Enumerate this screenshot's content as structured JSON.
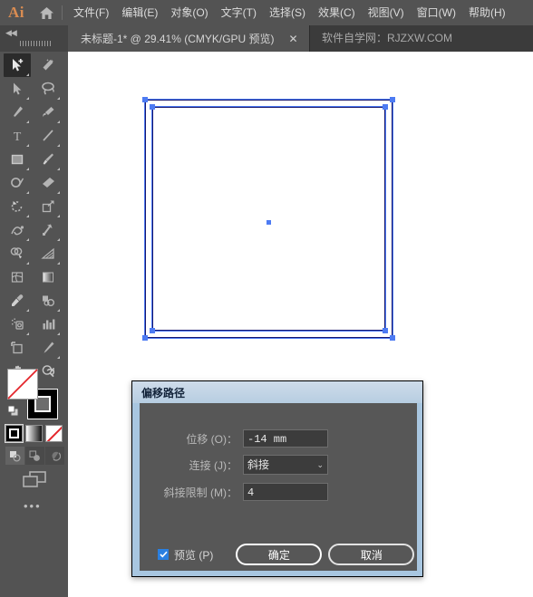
{
  "app": {
    "logo_text": "Ai",
    "home_icon": "home-icon"
  },
  "menubar": {
    "items": [
      {
        "label": "文件(F)"
      },
      {
        "label": "编辑(E)"
      },
      {
        "label": "对象(O)"
      },
      {
        "label": "文字(T)"
      },
      {
        "label": "选择(S)"
      },
      {
        "label": "效果(C)"
      },
      {
        "label": "视图(V)"
      },
      {
        "label": "窗口(W)"
      },
      {
        "label": "帮助(H)"
      }
    ]
  },
  "tabbar": {
    "document_title": "未标题-1* @ 29.41% (CMYK/GPU 预览)",
    "close_label": "✕",
    "watermark": "软件自学网：RJZXW.COM",
    "collapse_label": "◀◀"
  },
  "toolbar": {
    "tools": [
      {
        "name": "selection-plus-tool",
        "active": true
      },
      {
        "name": "magic-wand-tool",
        "active": false
      },
      {
        "name": "direct-selection-tool",
        "active": false
      },
      {
        "name": "lasso-tool",
        "active": false
      },
      {
        "name": "pen-tool",
        "active": false
      },
      {
        "name": "curvature-tool",
        "active": false
      },
      {
        "name": "type-tool",
        "active": false
      },
      {
        "name": "line-segment-tool",
        "active": false
      },
      {
        "name": "rectangle-tool",
        "active": false
      },
      {
        "name": "paintbrush-tool",
        "active": false
      },
      {
        "name": "shaper-tool",
        "active": false
      },
      {
        "name": "eraser-tool",
        "active": false
      },
      {
        "name": "rotate-tool",
        "active": false
      },
      {
        "name": "scale-tool",
        "active": false
      },
      {
        "name": "width-tool",
        "active": false
      },
      {
        "name": "free-transform-tool",
        "active": false
      },
      {
        "name": "shape-builder-tool",
        "active": false
      },
      {
        "name": "perspective-grid-tool",
        "active": false
      },
      {
        "name": "mesh-tool",
        "active": false
      },
      {
        "name": "gradient-tool",
        "active": false
      },
      {
        "name": "eyedropper-tool",
        "active": false
      },
      {
        "name": "blend-tool",
        "active": false
      },
      {
        "name": "symbol-sprayer-tool",
        "active": false
      },
      {
        "name": "column-graph-tool",
        "active": false
      },
      {
        "name": "artboard-tool",
        "active": false
      },
      {
        "name": "slice-tool",
        "active": false
      },
      {
        "name": "hand-tool",
        "active": false
      },
      {
        "name": "zoom-tool",
        "active": false
      }
    ],
    "fill_color": "#ffffff",
    "stroke_color": "#000000",
    "color_modes": [
      "color-mode-button",
      "gradient-mode-button",
      "none-mode-button"
    ],
    "draw_modes": [
      "draw-normal-button",
      "draw-behind-button",
      "draw-inside-button"
    ],
    "screen_mode": "screen-mode-button",
    "more_tools": "•••"
  },
  "canvas": {
    "background": "#ffffff",
    "artwork_stroke": "#16166e",
    "selection_color": "#4d7bf3"
  },
  "dialog": {
    "title": "偏移路径",
    "fields": [
      {
        "label": "位移 (O)：",
        "value": "-14 mm",
        "type": "text"
      },
      {
        "label": "连接 (J)：",
        "value": "斜接",
        "type": "select",
        "chevron": "⌄"
      },
      {
        "label": "斜接限制 (M)：",
        "value": "4",
        "type": "text"
      }
    ],
    "preview_label": "预览 (P)",
    "preview_checked": true,
    "ok_label": "确定",
    "cancel_label": "取消",
    "accent_color": "#2a7fe0",
    "titlebar_color": "#b6cde1"
  }
}
